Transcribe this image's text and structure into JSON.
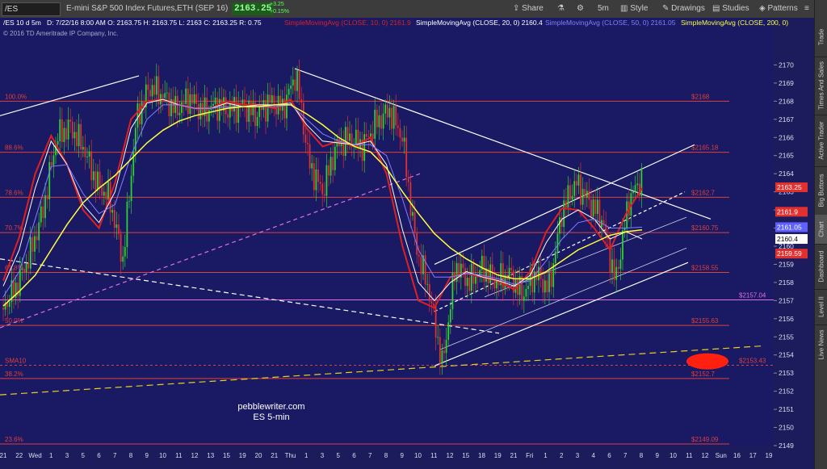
{
  "toolbar": {
    "symbol": "/ES",
    "description": "E-mini S&P 500 Index Futures,ETH (SEP 16)",
    "last": "2163.25",
    "change": "+3.25",
    "change_pct": "+0.15%",
    "share": "Share",
    "interval": "5m",
    "style": "Style",
    "drawings": "Drawings",
    "studies": "Studies",
    "patterns": "Patterns"
  },
  "sidebar": [
    "Trade",
    "Times And Sales",
    "Active Trader",
    "Big Buttons",
    "Chart",
    "Dashboard",
    "Level II",
    "Live News"
  ],
  "header": {
    "symbol": "/ES 10 d 5m",
    "ohlc": "D: 7/22/16 8:00 AM  O: 2163.75  H: 2163.75  L: 2163  C: 2163.25  R: 0.75",
    "studies": [
      {
        "text": "SimpleMovingAvg (CLOSE, 10, 0)  2161.9",
        "color": "#e02020"
      },
      {
        "text": "SimpleMovingAvg (CLOSE, 20, 0)  2160.4",
        "color": "#ffffff"
      },
      {
        "text": "SimpleMovingAvg (CLOSE, 50, 0)  2161.05",
        "color": "#8080ff"
      },
      {
        "text": "SimpleMovingAvg (CLOSE, 200, 0)",
        "color": "#ffff40"
      }
    ],
    "copyright": "© 2016 TD Ameritrade IP Company, Inc."
  },
  "colors": {
    "background": "#191964",
    "fib": "#e0403a",
    "sma10": "#e02020",
    "sma20": "#ffffff",
    "sma50": "#8080ff",
    "sma200": "#ffff40",
    "channel": "#ffffff",
    "support": "#e8d020",
    "purple": "#8a2be2",
    "magenta": "#e070e0",
    "up": "#30d030",
    "down": "#e03030"
  },
  "chart_data": {
    "type": "candlestick",
    "title": "pebblewriter.com\nES 5-min",
    "ylim": [
      2149,
      2171
    ],
    "y_ticks": [
      2149,
      2150,
      2151,
      2152,
      2153,
      2154,
      2155,
      2156,
      2157,
      2158,
      2159,
      2160,
      2161,
      2162,
      2163,
      2164,
      2165,
      2166,
      2167,
      2168,
      2169,
      2170
    ],
    "x_tick_labels": [
      "21",
      "22",
      "Wed",
      "1",
      "3",
      "5",
      "6",
      "7",
      "8",
      "9",
      "10",
      "11",
      "12",
      "13",
      "15",
      "19",
      "20",
      "21",
      "Thu",
      "1",
      "3",
      "5",
      "6",
      "7",
      "8",
      "9",
      "10",
      "11",
      "12",
      "15",
      "18",
      "19",
      "21",
      "Fri",
      "1",
      "2",
      "3",
      "4",
      "6",
      "7",
      "8",
      "9",
      "10",
      "11",
      "12",
      "Sun",
      "16",
      "17",
      "19"
    ],
    "fib_levels": [
      {
        "pct": "100.0%",
        "value": 2168
      },
      {
        "pct": "88.6%",
        "value": 2165.18
      },
      {
        "pct": "78.6%",
        "value": 2162.7
      },
      {
        "pct": "70.7%",
        "value": 2160.75
      },
      {
        "pct": "61.8%",
        "value": 2158.55
      },
      {
        "pct": "50.0%",
        "value": 2155.63
      },
      {
        "pct": "38.2%",
        "value": 2152.7
      },
      {
        "pct": "23.6%",
        "value": 2149.09
      }
    ],
    "fib_value_labels": [
      "$2168",
      "$2165.18",
      "$2162.7",
      "$2160.75",
      "$2158.55",
      "$2155.63",
      "$2152.7",
      "$2149.09"
    ],
    "purple_level": {
      "value": 2157.04,
      "label": "$2157.04"
    },
    "sma10_level": {
      "value": 2153.43,
      "label": "$2153.43",
      "name": "SMA10"
    },
    "price_markers": [
      {
        "value": 2163.25,
        "label": "2163.25",
        "color": "#e03030"
      },
      {
        "value": 2161.9,
        "label": "2161.9",
        "color": "#e03030"
      },
      {
        "value": 2161.05,
        "label": "2161.05",
        "color": "#6060ff"
      },
      {
        "value": 2160.4,
        "label": "2160.4",
        "color": "#ffffff"
      },
      {
        "value": 2159.59,
        "label": "2159.59",
        "color": "#e03030"
      }
    ],
    "series": [
      {
        "name": "SimpleMovingAvg (CLOSE, 10, 0)",
        "values": [
          2158.1,
          2160.5,
          2164.0,
          2166.1,
          2164.5,
          2162.0,
          2161.0,
          2163.5,
          2167.0,
          2168.0,
          2168.1,
          2167.8,
          2167.6,
          2167.6,
          2168.0,
          2167.8,
          2167.8,
          2167.6,
          2168.1,
          2166.5,
          2165.5,
          2165.8,
          2165.5,
          2166.0,
          2164.0,
          2160.0,
          2157.0,
          2156.6,
          2158.3,
          2158.5,
          2158.3,
          2158.1,
          2157.6,
          2158.6,
          2160.8,
          2162.1,
          2162.0,
          2161.0,
          2159.8,
          2161.8,
          2163.2
        ]
      },
      {
        "name": "SimpleMovingAvg (CLOSE, 20, 0)",
        "values": [
          2157.8,
          2159.8,
          2163.2,
          2165.8,
          2164.5,
          2162.3,
          2161.3,
          2163.0,
          2166.5,
          2167.9,
          2168.1,
          2167.8,
          2167.6,
          2167.6,
          2167.9,
          2167.7,
          2167.8,
          2167.8,
          2167.9,
          2166.7,
          2165.8,
          2165.7,
          2165.6,
          2165.8,
          2164.5,
          2160.9,
          2158.0,
          2157.0,
          2158.0,
          2158.6,
          2158.3,
          2158.1,
          2157.8,
          2158.4,
          2160.2,
          2161.5,
          2162.0,
          2161.5,
          2160.4,
          2160.8,
          2160.4
        ]
      },
      {
        "name": "SimpleMovingAvg (CLOSE, 50, 0)",
        "values": [
          2157.2,
          2158.6,
          2161.5,
          2164.4,
          2164.5,
          2162.9,
          2161.8,
          2162.3,
          2165.0,
          2167.0,
          2167.8,
          2167.8,
          2167.6,
          2167.6,
          2167.7,
          2167.7,
          2167.7,
          2167.7,
          2167.8,
          2167.0,
          2166.2,
          2165.8,
          2165.6,
          2165.6,
          2165.0,
          2162.6,
          2159.8,
          2158.3,
          2158.3,
          2158.5,
          2158.4,
          2158.2,
          2157.9,
          2158.1,
          2159.2,
          2160.4,
          2161.3,
          2161.5,
          2161.0,
          2161.0,
          2161.05
        ]
      },
      {
        "name": "SimpleMovingAvg (CLOSE, 200, 0)",
        "values": [
          2156.7,
          2157.5,
          2158.4,
          2159.8,
          2161.2,
          2162.4,
          2163.2,
          2163.9,
          2164.8,
          2165.7,
          2166.4,
          2166.9,
          2167.2,
          2167.4,
          2167.6,
          2167.7,
          2167.7,
          2167.8,
          2167.8,
          2167.3,
          2166.7,
          2166.0,
          2165.5,
          2165.2,
          2164.3,
          2163.0,
          2161.8,
          2160.7,
          2159.9,
          2159.3,
          2158.8,
          2158.4,
          2158.2,
          2158.2,
          2158.6,
          2159.2,
          2159.8,
          2160.2,
          2160.6,
          2160.8,
          2160.9
        ]
      }
    ],
    "price_path": [
      2156.6,
      2157.8,
      2159.5,
      2162.0,
      2166.0,
      2166.6,
      2165.5,
      2163.5,
      2162.6,
      2159.2,
      2167.0,
      2168.8,
      2168.3,
      2167.5,
      2168.2,
      2167.4,
      2167.8,
      2167.5,
      2167.8,
      2167.2,
      2168.0,
      2167.6,
      2169.5,
      2164.5,
      2163.0,
      2165.5,
      2166.0,
      2165.5,
      2166.8,
      2167.5,
      2166.0,
      2160.0,
      2157.5,
      2153.4,
      2159.0,
      2158.0,
      2158.8,
      2158.0,
      2158.5,
      2157.3,
      2158.5,
      2157.6,
      2162.0,
      2163.5,
      2162.5,
      2161.5,
      2158.0,
      2162.5,
      2163.8
    ]
  },
  "watermark": [
    "pebblewriter.com",
    "ES 5-min"
  ]
}
